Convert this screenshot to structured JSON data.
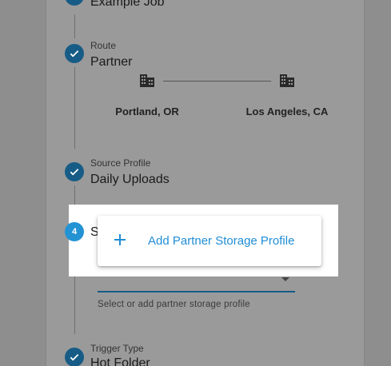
{
  "steps": {
    "job": {
      "value": "Example Job"
    },
    "route": {
      "label": "Route",
      "value": "Partner",
      "origin": "Portland, OR",
      "destination": "Los Angeles, CA"
    },
    "source": {
      "label": "Source Profile",
      "value": "Daily Uploads"
    },
    "storage": {
      "number": "4",
      "value_partial": "S",
      "add_option": "Add Partner Storage Profile",
      "helper": "Select or add partner storage profile"
    },
    "trigger": {
      "label": "Trigger Type",
      "value": "Hot Folder"
    }
  },
  "icons": {
    "check": "check-icon",
    "building": "building-icon",
    "plus": "plus-icon",
    "dropdown": "dropdown-arrow-icon"
  },
  "colors": {
    "completed_step": "#175c86",
    "active_step": "#2393d4",
    "accent_text": "#1f8dd6"
  }
}
